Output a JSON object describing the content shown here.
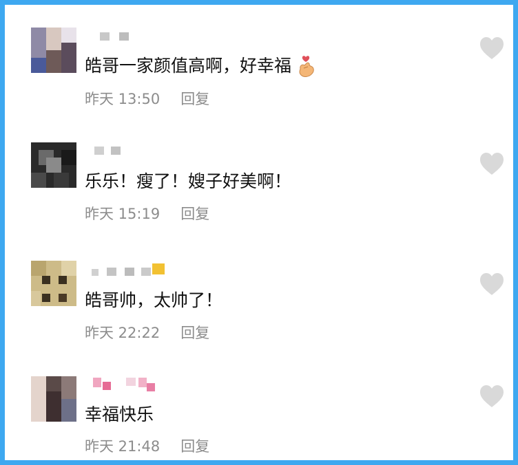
{
  "comments": [
    {
      "text": "皓哥一家颜值高啊，好幸福",
      "emoji": "finger-heart-icon",
      "time": "昨天 13:50",
      "reply_label": "回复"
    },
    {
      "text": "乐乐！瘦了！嫂子好美啊！",
      "time": "昨天 15:19",
      "reply_label": "回复"
    },
    {
      "text": "皓哥帅，太帅了！",
      "time": "昨天 22:22",
      "reply_label": "回复"
    },
    {
      "text": "幸福快乐",
      "time": "昨天 21:48",
      "reply_label": "回复"
    }
  ],
  "colors": {
    "border": "#3ea8f0",
    "text": "#111111",
    "meta": "#8c8c8c",
    "heart": "#d9d9d9"
  }
}
